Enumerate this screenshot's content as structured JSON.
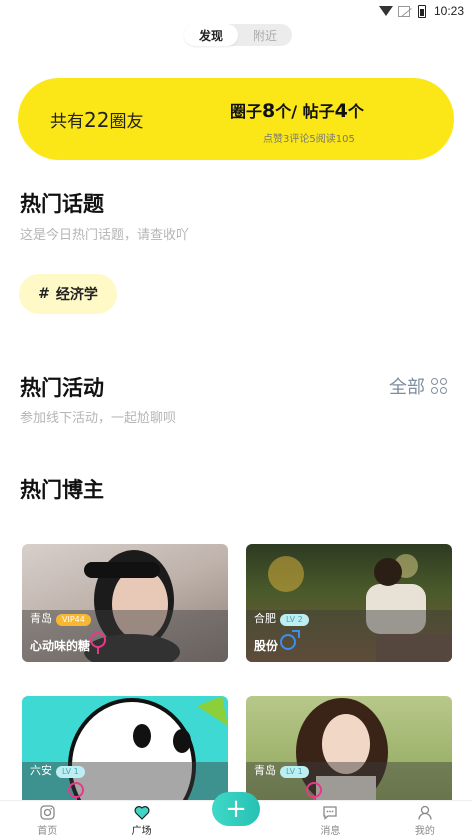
{
  "status_bar": {
    "time": "10:23"
  },
  "top_tabs": [
    {
      "label": "发现",
      "active": true
    },
    {
      "label": "附近",
      "active": false
    }
  ],
  "summary": {
    "members_prefix": "共有",
    "members_count": "22",
    "members_suffix": "圈友",
    "circles_prefix": "圈子",
    "circles_count": "8",
    "circles_suffix": "个/ 帖子",
    "posts_count": "4",
    "posts_suffix": "个",
    "stats": "点赞3评论5阅读105",
    "accent_color": "#fbe718"
  },
  "hot_topics": {
    "title": "热门话题",
    "subtitle": "这是今日热门话题，请查收吖",
    "chips": [
      {
        "hash": "#",
        "label": "经济学"
      }
    ]
  },
  "hot_activities": {
    "title": "热门活动",
    "subtitle": "参加线下活动，一起尬聊呗",
    "all_label": "全部"
  },
  "hot_bloggers": {
    "title": "热门博主",
    "cards": [
      {
        "city": "青岛",
        "badge": "VIP44",
        "badge_type": "vip",
        "name": "心动味的糖",
        "gender": "female"
      },
      {
        "city": "合肥",
        "badge": "LV 2",
        "badge_type": "lv",
        "name": "股份",
        "gender": "male"
      },
      {
        "city": "六安",
        "badge": "LV 1",
        "badge_type": "lv",
        "name": "",
        "gender": "female"
      },
      {
        "city": "青岛",
        "badge": "LV 1",
        "badge_type": "lv",
        "name": "",
        "gender": "female"
      }
    ]
  },
  "bottom_nav": [
    {
      "label": "首页",
      "icon": "instagram-icon",
      "active": false
    },
    {
      "label": "广场",
      "icon": "heart-icon",
      "active": true
    },
    {
      "label": "消息",
      "icon": "chat-icon",
      "active": false
    },
    {
      "label": "我的",
      "icon": "user-icon",
      "active": false
    }
  ],
  "plus_button": "+"
}
